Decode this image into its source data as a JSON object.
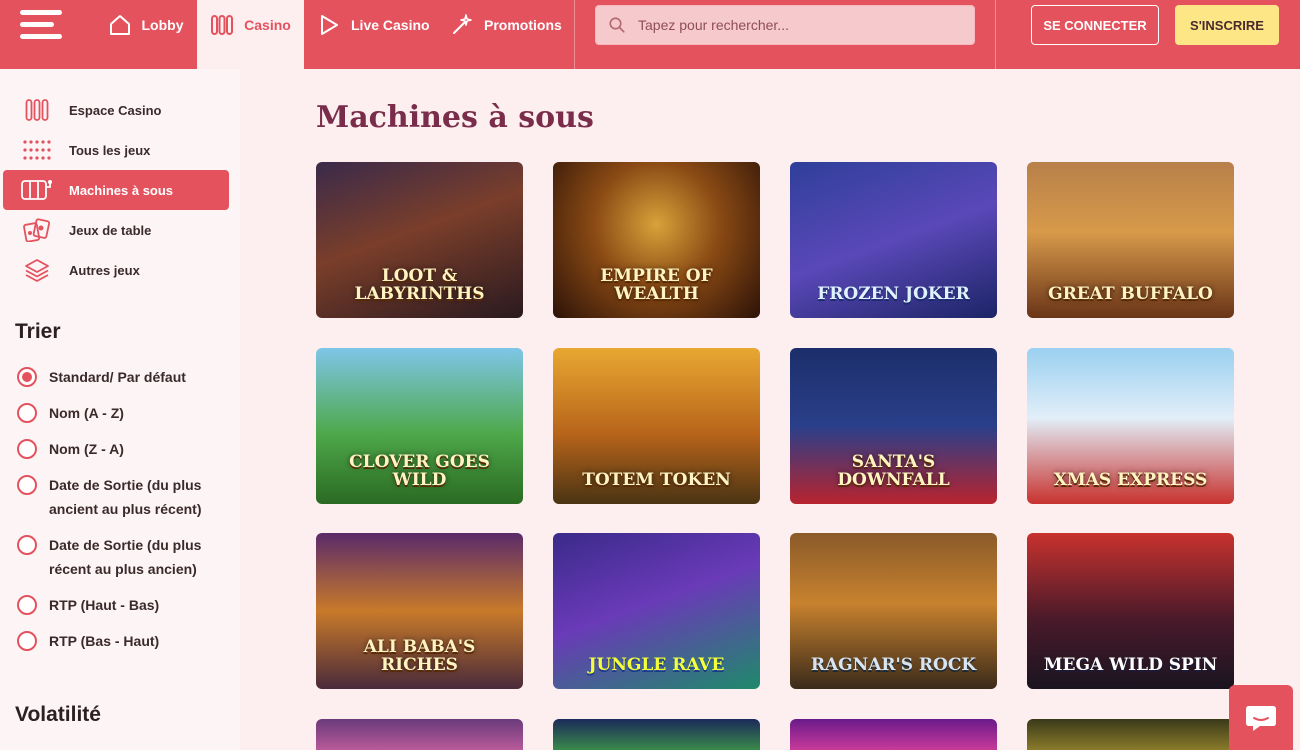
{
  "header": {
    "nav": [
      {
        "label": "Lobby"
      },
      {
        "label": "Casino"
      },
      {
        "label": "Live Casino"
      },
      {
        "label": "Promotions"
      }
    ],
    "search_placeholder": "Tapez pour rechercher...",
    "login_label": "SE CONNECTER",
    "signup_label": "S'INSCRIRE"
  },
  "sidebar": {
    "items": [
      {
        "label": "Espace Casino",
        "icon": "slots-icon"
      },
      {
        "label": "Tous les jeux",
        "icon": "grid-dots-icon"
      },
      {
        "label": "Machines à sous",
        "icon": "slot-machine-icon"
      },
      {
        "label": "Jeux de table",
        "icon": "cards-icon"
      },
      {
        "label": "Autres jeux",
        "icon": "layers-icon"
      }
    ],
    "sort_title": "Trier",
    "sort_options": [
      {
        "label": "Standard/ Par défaut",
        "checked": true
      },
      {
        "label": "Nom (A - Z)",
        "checked": false
      },
      {
        "label": "Nom (Z - A)",
        "checked": false
      },
      {
        "label": "Date de Sortie (du plus ancient au plus récent)",
        "checked": false
      },
      {
        "label": "Date de Sortie (du plus récent au plus ancien)",
        "checked": false
      },
      {
        "label": "RTP (Haut - Bas)",
        "checked": false
      },
      {
        "label": "RTP (Bas - Haut)",
        "checked": false
      }
    ],
    "volatility_title": "Volatilité"
  },
  "main": {
    "title": "Machines à sous",
    "games": [
      {
        "name": "Loot & Labyrinths"
      },
      {
        "name": "Empire of Wealth"
      },
      {
        "name": "Frozen Joker"
      },
      {
        "name": "Great Buffalo"
      },
      {
        "name": "Clover goes Wild"
      },
      {
        "name": "Totem Token"
      },
      {
        "name": "Santa's Downfall"
      },
      {
        "name": "Xmas Express"
      },
      {
        "name": "Ali Baba's Riches"
      },
      {
        "name": "Jungle Rave"
      },
      {
        "name": "Ragnar's Rock"
      },
      {
        "name": "Mega Wild Spin"
      }
    ]
  },
  "colors": {
    "brand": "#e4525e",
    "accent_yellow": "#fde686",
    "title": "#7a2d4a",
    "background": "#fdeff0"
  }
}
